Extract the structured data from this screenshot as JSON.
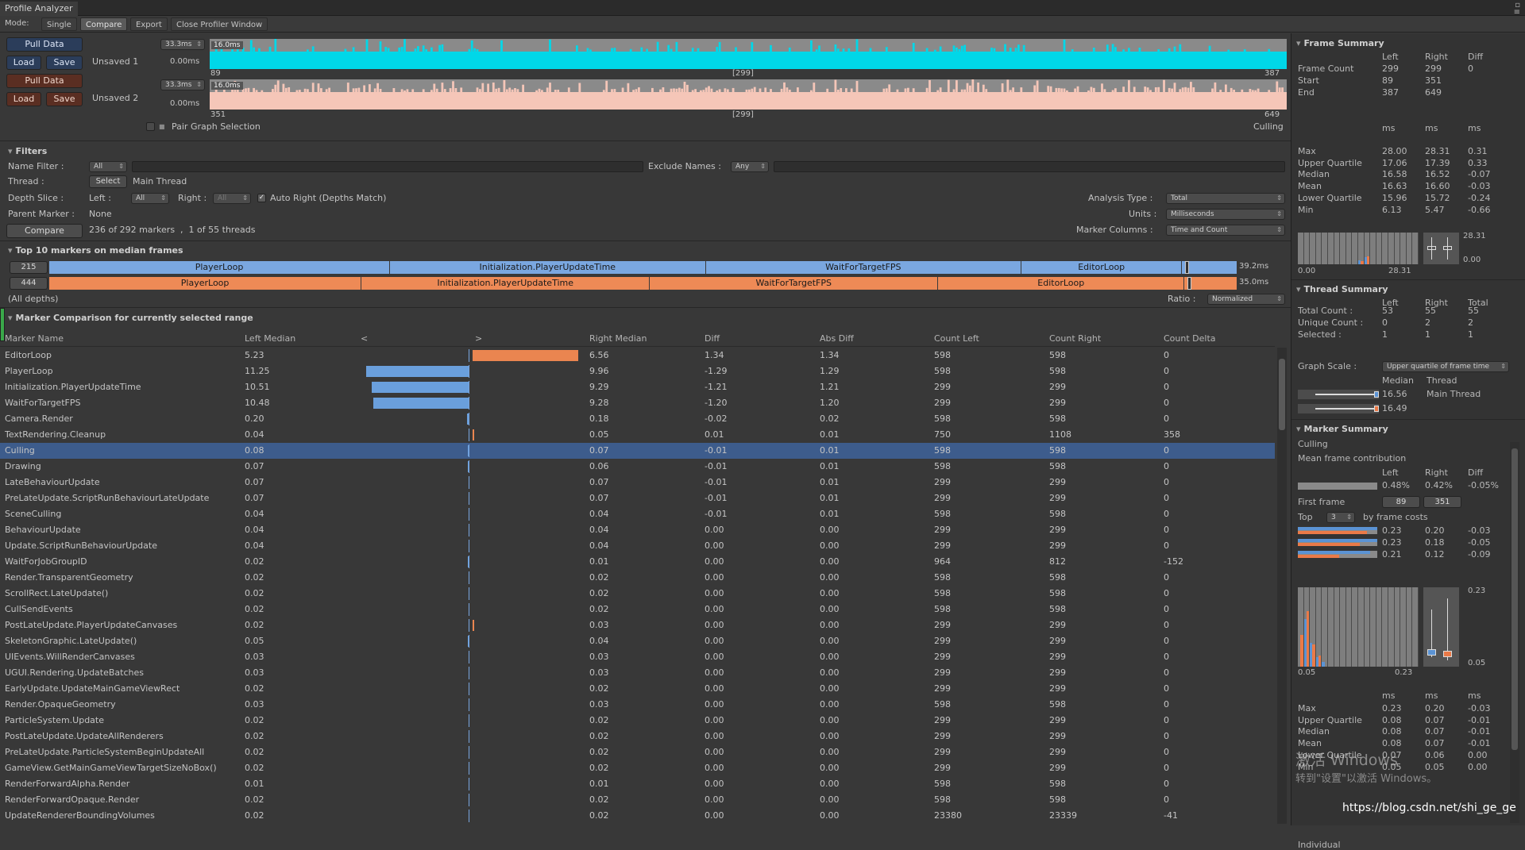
{
  "window": {
    "title": "Profile Analyzer"
  },
  "modebar": {
    "mode_label": "Mode:",
    "tabs": [
      "Single",
      "Compare",
      "Export",
      "Close Profiler Window"
    ],
    "active": "Compare"
  },
  "data_panel": {
    "left": {
      "pull": "Pull Data",
      "load": "Load",
      "save": "Save",
      "name": "Unsaved 1",
      "scale_dd": "33.3ms",
      "min_label": "0.00ms",
      "peak_label": "16.0ms",
      "start": "89",
      "mid": "[299]",
      "end": "387",
      "color": "#00d7e8"
    },
    "right": {
      "pull": "Pull Data",
      "load": "Load",
      "save": "Save",
      "name": "Unsaved 2",
      "scale_dd": "33.3ms",
      "min_label": "0.00ms",
      "peak_label": "16.0ms",
      "start": "351",
      "mid": "[299]",
      "end": "649",
      "color": "#f5c6b8"
    },
    "pair_label": "Pair Graph Selection",
    "selected_marker": "Culling"
  },
  "filters": {
    "title": "Filters",
    "name_filter_label": "Name Filter :",
    "name_filter_dd": "All",
    "exclude_label": "Exclude Names :",
    "exclude_dd": "Any",
    "thread_label": "Thread :",
    "select_btn": "Select",
    "thread_value": "Main Thread",
    "depth_label": "Depth Slice :",
    "left_label": "Left :",
    "left_dd": "All",
    "right_label": "Right :",
    "right_dd": "All",
    "auto_right": "Auto Right (Depths Match)",
    "parent_label": "Parent Marker :",
    "parent_value": "None",
    "compare_btn": "Compare",
    "markers_info": "236 of 292 markers",
    "threads_info": "1 of 55 threads",
    "analysis_label": "Analysis Type :",
    "analysis_dd": "Total",
    "units_label": "Units :",
    "units_dd": "Milliseconds",
    "columns_label": "Marker Columns :",
    "columns_dd": "Time and Count"
  },
  "top10": {
    "title": "Top 10 markers on median frames",
    "left_frame": "215",
    "right_frame": "444",
    "left_total": "39.2ms",
    "right_total": "35.0ms",
    "left_segments": [
      {
        "name": "PlayerLoop",
        "frac": 0.299
      },
      {
        "name": "Initialization.PlayerUpdateTime",
        "frac": 0.277
      },
      {
        "name": "WaitForTargetFPS",
        "frac": 0.277
      },
      {
        "name": "EditorLoop",
        "frac": 0.141
      }
    ],
    "right_segments": [
      {
        "name": "PlayerLoop",
        "frac": 0.274
      },
      {
        "name": "Initialization.PlayerUpdateTime",
        "frac": 0.253
      },
      {
        "name": "WaitForTargetFPS",
        "frac": 0.253
      },
      {
        "name": "EditorLoop",
        "frac": 0.216
      }
    ],
    "depth_note": "(All depths)",
    "ratio_label": "Ratio :",
    "ratio_dd": "Normalized"
  },
  "comparison": {
    "title": "Marker Comparison for currently selected range",
    "columns": [
      "Marker Name",
      "Left Median",
      "<",
      ">",
      "Right Median",
      "Diff",
      "Abs Diff",
      "Count Left",
      "Count Right",
      "Count Delta"
    ],
    "selected_index": 6,
    "rows": [
      [
        "EditorLoop",
        "5.23",
        "6.56",
        "1.34",
        "1.34",
        "598",
        "598",
        "0"
      ],
      [
        "PlayerLoop",
        "11.25",
        "9.96",
        "-1.29",
        "1.29",
        "598",
        "598",
        "0"
      ],
      [
        "Initialization.PlayerUpdateTime",
        "10.51",
        "9.29",
        "-1.21",
        "1.21",
        "299",
        "299",
        "0"
      ],
      [
        "WaitForTargetFPS",
        "10.48",
        "9.28",
        "-1.20",
        "1.20",
        "299",
        "299",
        "0"
      ],
      [
        "Camera.Render",
        "0.20",
        "0.18",
        "-0.02",
        "0.02",
        "598",
        "598",
        "0"
      ],
      [
        "TextRendering.Cleanup",
        "0.04",
        "0.05",
        "0.01",
        "0.01",
        "750",
        "1108",
        "358"
      ],
      [
        "Culling",
        "0.08",
        "0.07",
        "-0.01",
        "0.01",
        "598",
        "598",
        "0"
      ],
      [
        "Drawing",
        "0.07",
        "0.06",
        "-0.01",
        "0.01",
        "598",
        "598",
        "0"
      ],
      [
        "LateBehaviourUpdate",
        "0.07",
        "0.07",
        "-0.01",
        "0.01",
        "299",
        "299",
        "0"
      ],
      [
        "PreLateUpdate.ScriptRunBehaviourLateUpdate",
        "0.07",
        "0.07",
        "-0.01",
        "0.01",
        "299",
        "299",
        "0"
      ],
      [
        "SceneCulling",
        "0.04",
        "0.04",
        "-0.01",
        "0.01",
        "598",
        "598",
        "0"
      ],
      [
        "BehaviourUpdate",
        "0.04",
        "0.04",
        "0.00",
        "0.00",
        "299",
        "299",
        "0"
      ],
      [
        "Update.ScriptRunBehaviourUpdate",
        "0.04",
        "0.04",
        "0.00",
        "0.00",
        "299",
        "299",
        "0"
      ],
      [
        "WaitForJobGroupID",
        "0.02",
        "0.01",
        "0.00",
        "0.00",
        "964",
        "812",
        "-152"
      ],
      [
        "Render.TransparentGeometry",
        "0.02",
        "0.02",
        "0.00",
        "0.00",
        "598",
        "598",
        "0"
      ],
      [
        "ScrollRect.LateUpdate()",
        "0.02",
        "0.02",
        "0.00",
        "0.00",
        "598",
        "598",
        "0"
      ],
      [
        "CullSendEvents",
        "0.02",
        "0.02",
        "0.00",
        "0.00",
        "598",
        "598",
        "0"
      ],
      [
        "PostLateUpdate.PlayerUpdateCanvases",
        "0.02",
        "0.03",
        "0.00",
        "0.00",
        "299",
        "299",
        "0"
      ],
      [
        "SkeletonGraphic.LateUpdate()",
        "0.05",
        "0.04",
        "0.00",
        "0.00",
        "299",
        "299",
        "0"
      ],
      [
        "UIEvents.WillRenderCanvases",
        "0.03",
        "0.03",
        "0.00",
        "0.00",
        "299",
        "299",
        "0"
      ],
      [
        "UGUI.Rendering.UpdateBatches",
        "0.03",
        "0.03",
        "0.00",
        "0.00",
        "299",
        "299",
        "0"
      ],
      [
        "EarlyUpdate.UpdateMainGameViewRect",
        "0.02",
        "0.02",
        "0.00",
        "0.00",
        "299",
        "299",
        "0"
      ],
      [
        "Render.OpaqueGeometry",
        "0.03",
        "0.03",
        "0.00",
        "0.00",
        "598",
        "598",
        "0"
      ],
      [
        "ParticleSystem.Update",
        "0.02",
        "0.02",
        "0.00",
        "0.00",
        "299",
        "299",
        "0"
      ],
      [
        "PostLateUpdate.UpdateAllRenderers",
        "0.02",
        "0.02",
        "0.00",
        "0.00",
        "299",
        "299",
        "0"
      ],
      [
        "PreLateUpdate.ParticleSystemBeginUpdateAll",
        "0.02",
        "0.02",
        "0.00",
        "0.00",
        "299",
        "299",
        "0"
      ],
      [
        "GameView.GetMainGameViewTargetSizeNoBox()",
        "0.02",
        "0.02",
        "0.00",
        "0.00",
        "299",
        "299",
        "0"
      ],
      [
        "RenderForwardAlpha.Render",
        "0.01",
        "0.01",
        "0.00",
        "0.00",
        "598",
        "598",
        "0"
      ],
      [
        "RenderForwardOpaque.Render",
        "0.02",
        "0.02",
        "0.00",
        "0.00",
        "598",
        "598",
        "0"
      ],
      [
        "UpdateRendererBoundingVolumes",
        "0.02",
        "0.02",
        "0.00",
        "0.00",
        "23380",
        "23339",
        "-41"
      ]
    ]
  },
  "frame_summary": {
    "title": "Frame Summary",
    "head": [
      "Left",
      "Right",
      "Diff"
    ],
    "rows": [
      [
        "Frame Count",
        "299",
        "299",
        "0"
      ],
      [
        "Start",
        "89",
        "351",
        ""
      ],
      [
        "End",
        "387",
        "649",
        ""
      ]
    ],
    "units": [
      "ms",
      "ms",
      "ms"
    ],
    "stats": [
      [
        "Max",
        "28.00",
        "28.31",
        "0.31"
      ],
      [
        "Upper Quartile",
        "17.06",
        "17.39",
        "0.33"
      ],
      [
        "Median",
        "16.58",
        "16.52",
        "-0.07"
      ],
      [
        "Mean",
        "16.63",
        "16.60",
        "-0.03"
      ],
      [
        "Lower Quartile",
        "15.96",
        "15.72",
        "-0.24"
      ],
      [
        "Min",
        "6.13",
        "5.47",
        "-0.66"
      ]
    ],
    "hist_min": "0.00",
    "hist_max": "28.31",
    "box_max": "28.31",
    "box_min": "0.00"
  },
  "thread_summary": {
    "title": "Thread Summary",
    "head": [
      "Left",
      "Right",
      "Total"
    ],
    "rows": [
      [
        "Total Count :",
        "53",
        "55",
        "55"
      ],
      [
        "Unique Count :",
        "0",
        "2",
        "2"
      ],
      [
        "Selected :",
        "1",
        "1",
        "1"
      ]
    ],
    "scale_label": "Graph Scale :",
    "scale_dd": "Upper quartile of frame time",
    "col_median": "Median",
    "col_thread": "Thread",
    "left_median": "16.56",
    "right_median": "16.49",
    "thread_name": "Main Thread"
  },
  "marker_summary": {
    "title": "Marker Summary",
    "marker": "Culling",
    "contrib_label": "Mean frame contribution",
    "head": [
      "Left",
      "Right",
      "Diff"
    ],
    "contrib": [
      "0.48%",
      "0.42%",
      "-0.05%"
    ],
    "first_frame_label": "First frame",
    "first_left": "89",
    "first_right": "351",
    "top_label": "Top",
    "top_dd": "3",
    "top_suffix": "by frame costs",
    "top_rows": [
      [
        "0.23",
        "0.20",
        "-0.03"
      ],
      [
        "0.23",
        "0.18",
        "-0.05"
      ],
      [
        "0.21",
        "0.12",
        "-0.09"
      ]
    ],
    "hist_min": "0.05",
    "hist_max": "0.23",
    "box_max": "0.23",
    "box_min": "0.05",
    "units": [
      "ms",
      "ms",
      "ms"
    ],
    "stats": [
      [
        "Max",
        "0.23",
        "0.20",
        "-0.03"
      ],
      [
        "Upper Quartile",
        "0.08",
        "0.07",
        "-0.01"
      ],
      [
        "Median",
        "0.08",
        "0.07",
        "-0.01"
      ],
      [
        "Mean",
        "0.08",
        "0.07",
        "-0.01"
      ],
      [
        "Lower Quartile",
        "0.07",
        "0.06",
        "0.00"
      ],
      [
        "Min",
        "0.05",
        "0.05",
        "0.00"
      ]
    ],
    "individual_label": "Individual"
  },
  "overlay": {
    "watermark_1": "激活 Windows",
    "watermark_2": "转到\"设置\"以激活 Windows。",
    "url": "https://blog.csdn.net/shi_ge_ge"
  },
  "colors": {
    "left": "#5b93d4",
    "right": "#ea7a48",
    "selection": "#3d5c8c",
    "left_graph": "#00d7e8",
    "right_graph": "#f5c6b8"
  }
}
